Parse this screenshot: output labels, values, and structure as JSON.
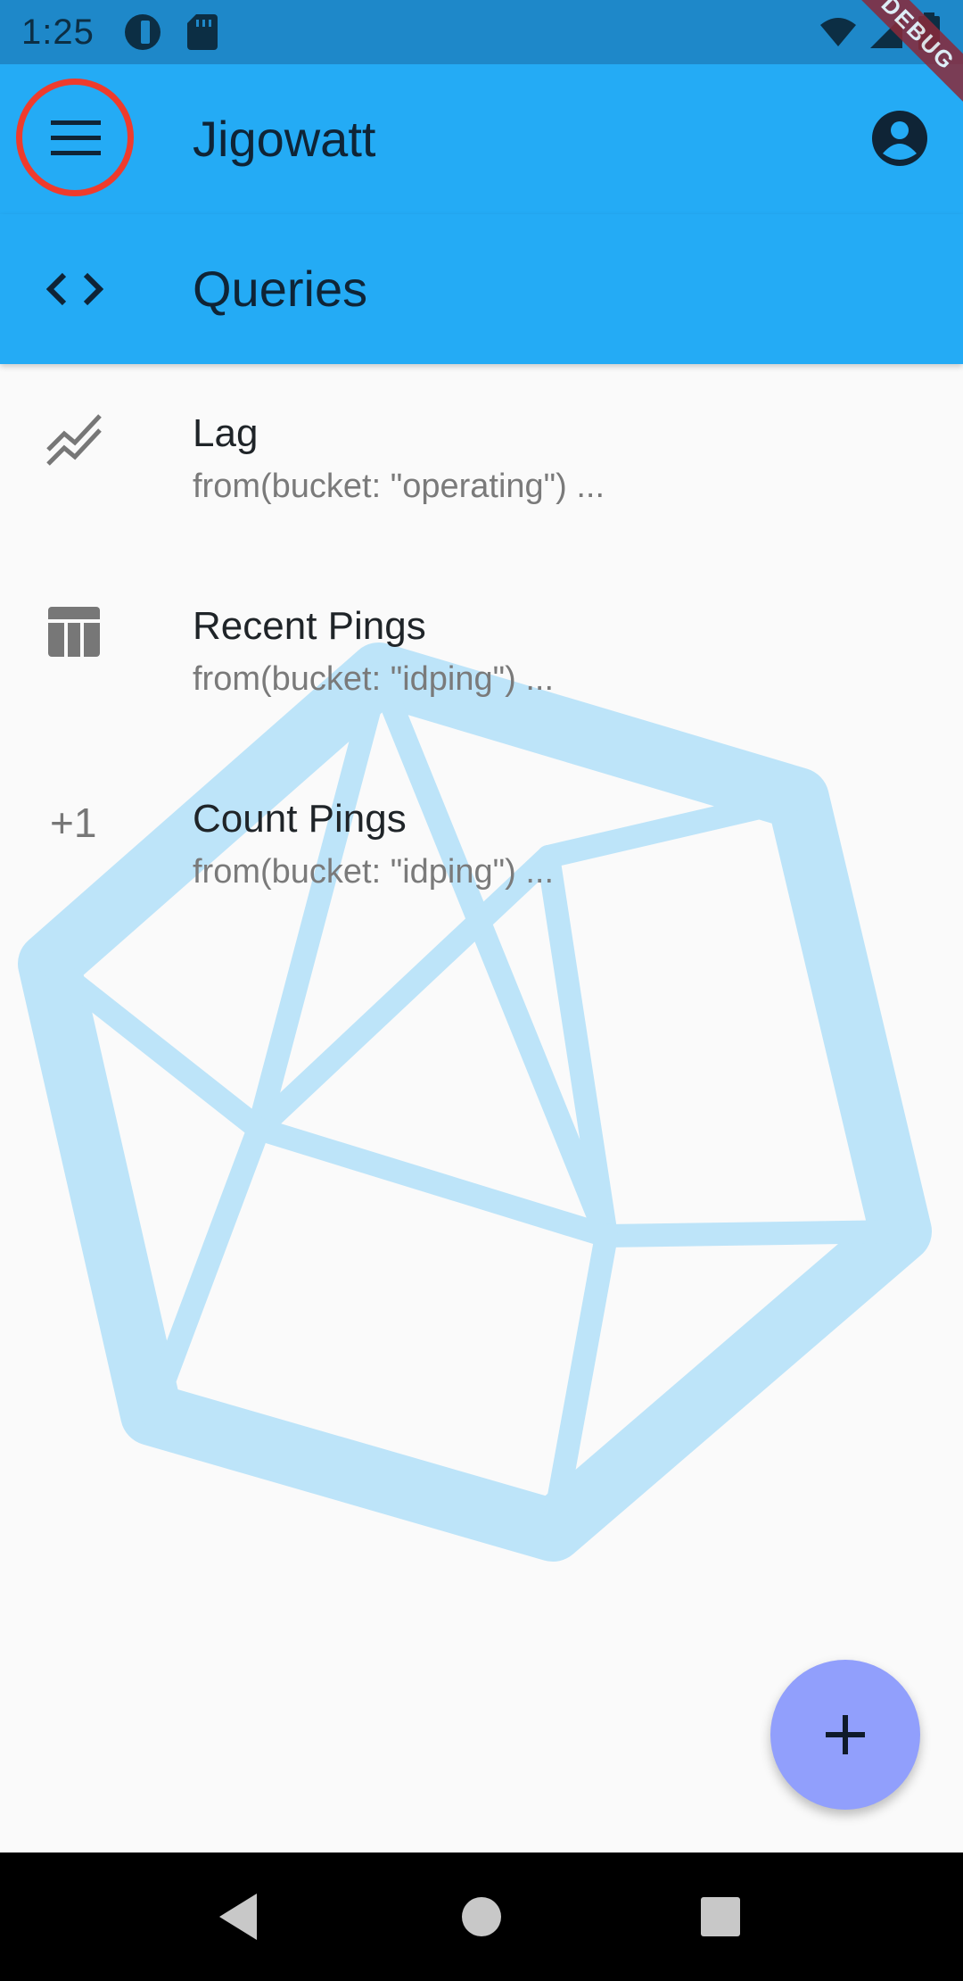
{
  "status_bar": {
    "time": "1:25",
    "icons": [
      "vpn-key-icon",
      "sd-card-icon",
      "wifi-icon",
      "signal-icon",
      "battery-icon"
    ]
  },
  "debug_banner": {
    "label": "DEBUG"
  },
  "app_bar": {
    "title": "Jigowatt",
    "menu_icon": "menu-icon",
    "account_icon": "account-circle-icon"
  },
  "section": {
    "title": "Queries",
    "icon": "code-icon"
  },
  "queries": [
    {
      "title": "Lag",
      "subtitle": "from(bucket: \"operating\") ...",
      "icon": "multiline-chart-icon"
    },
    {
      "title": "Recent Pings",
      "subtitle": "from(bucket: \"idping\") ...",
      "icon": "table-icon"
    },
    {
      "title": "Count Pings",
      "subtitle": "from(bucket: \"idping\") ...",
      "icon_text": "+1"
    }
  ],
  "fab": {
    "icon": "add-icon"
  },
  "colors": {
    "status_bar": "#1e88c9",
    "app_bar": "#24abf5",
    "fab": "#919ffc",
    "highlight_ring": "#ef3b2c",
    "logo_watermark": "#bde4f9"
  }
}
